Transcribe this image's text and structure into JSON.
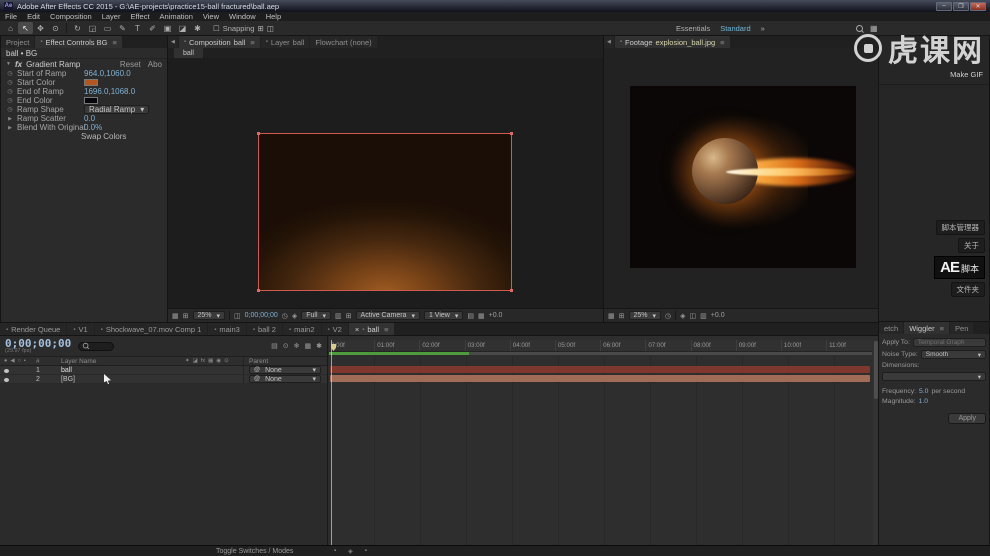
{
  "colors": {
    "render_bar_green": "#4f9a3d",
    "selection_red": "#cf5a50",
    "accent_value_blue": "#7fb0d4",
    "workspace_active_blue": "#6fb7d9"
  },
  "icons": {
    "panel_menu": "≡",
    "caret": "▾",
    "chevron_left": "◀",
    "close": "×",
    "tab_dot": "▪",
    "stopwatch": "◷",
    "twirl_open": "▼",
    "twirl_closed": "▶",
    "eye": "●",
    "audio": "◀",
    "solo": "○",
    "lock": "▪",
    "pickwhip": "@",
    "checkbox": "☐",
    "grid": "⊞",
    "safe_frame": "▦",
    "mask": "◫",
    "region": "▥",
    "channels": "◈",
    "flowchart_mini": "▤",
    "gear": "✱",
    "snowflake": "❄",
    "chart": "▦",
    "shy": "✦",
    "blend": "◪",
    "fx": "fx",
    "motion_blur": "▦",
    "adjustment": "◉",
    "cube": "⊙"
  },
  "window": {
    "app_badge": "Ae",
    "title": "Adobe After Effects CC 2015 - G:\\AE-projects\\practice15-ball fractured\\ball.aep",
    "minimize": "–",
    "maximize": "❐",
    "close": "✕"
  },
  "menu": {
    "items": [
      "File",
      "Edit",
      "Composition",
      "Layer",
      "Effect",
      "Animation",
      "View",
      "Window",
      "Help"
    ]
  },
  "toolbar": {
    "tools": [
      {
        "name": "home",
        "glyph": "⌂"
      },
      {
        "name": "selection",
        "glyph": "↖"
      },
      {
        "name": "hand",
        "glyph": "✥"
      },
      {
        "name": "zoom",
        "glyph": "⊙"
      },
      {
        "name": "orbit-camera",
        "glyph": "↻"
      },
      {
        "name": "pan-behind",
        "glyph": "◲"
      },
      {
        "name": "mask-shape",
        "glyph": "▭"
      },
      {
        "name": "pen",
        "glyph": "✎"
      },
      {
        "name": "type",
        "glyph": "T"
      },
      {
        "name": "brush",
        "glyph": "✐"
      },
      {
        "name": "clone-stamp",
        "glyph": "▣"
      },
      {
        "name": "eraser",
        "glyph": "◪"
      },
      {
        "name": "puppet-pin",
        "glyph": "✱"
      }
    ],
    "snapping_label": "Snapping",
    "workspaces": [
      {
        "label": "Essentials"
      },
      {
        "label": "Standard"
      }
    ],
    "overflow": "»"
  },
  "effect_controls": {
    "project_tab": "Project",
    "panel_title": "Effect Controls BG",
    "target": "ball • BG",
    "effect_header": {
      "fx": "fx",
      "name": "Gradient Ramp",
      "reset": "Reset",
      "about": "Abo"
    },
    "props": {
      "start_of_ramp": {
        "label": "Start of Ramp",
        "value": "964.0,1060.0"
      },
      "start_color": {
        "label": "Start Color",
        "swatch": "#b4561f"
      },
      "end_of_ramp": {
        "label": "End of Ramp",
        "value": "1696.0,1068.0"
      },
      "end_color": {
        "label": "End Color",
        "swatch": "#06060c"
      },
      "ramp_shape": {
        "label": "Ramp Shape",
        "value": "Radial Ramp"
      },
      "ramp_scatter": {
        "label": "Ramp Scatter",
        "value": "0.0"
      },
      "blend_with_original": {
        "label": "Blend With Original",
        "value": "0.0%"
      }
    },
    "swap_colors": "Swap Colors"
  },
  "composition": {
    "tab_composition": "Composition",
    "tab_composition_name": "ball",
    "tab_layer": "Layer",
    "tab_layer_name": "ball",
    "tab_flowchart": "Flowchart (none)",
    "viewer_tab": "ball",
    "statusbar": {
      "zoom": "25%",
      "timecode": "0;00;00;00",
      "resolution": "Full",
      "camera": "Active Camera",
      "views": "1 View",
      "exposure": "+0.0"
    }
  },
  "footage": {
    "tab_prefix": "Footage",
    "file_name": "explosion_ball.jpg",
    "statusbar": {
      "zoom": "25%",
      "exposure": "+0.0"
    }
  },
  "sidebar": {
    "watermark_text": "虎课网",
    "make_gif": "Make GIF",
    "script_manager": "脚本管理器",
    "about": "关于",
    "logo_big": "AE",
    "logo_small": "脚本",
    "folder": "文件夹"
  },
  "bottom_tabs": {
    "render_queue": "Render Queue",
    "comps": [
      "V1",
      "Shockwave_07.mov Comp 1",
      "main3",
      "ball 2",
      "main2",
      "V2"
    ],
    "active_comp": "ball"
  },
  "timeline": {
    "timecode": "0;00;00;00",
    "fps_note": "(29.97 fps)",
    "header": {
      "hash": "#",
      "layer_name": "Layer Name",
      "parent": "Parent"
    },
    "layers": [
      {
        "index": "1",
        "name": "ball",
        "parent": "None",
        "label_color": "#c03a2b",
        "bar_color": "#7e382d"
      },
      {
        "index": "2",
        "name": "[BG]",
        "parent": "None",
        "label_color": "#b26a58",
        "bar_color": "#a06c58"
      }
    ],
    "ruler": [
      "0:00f",
      "01:00f",
      "02:00f",
      "03:00f",
      "04:00f",
      "05:00f",
      "06:00f",
      "07:00f",
      "08:00f",
      "09:00f",
      "10:00f",
      "11:00f"
    ]
  },
  "wiggler": {
    "tab_partial": "etch",
    "tab_active": "Wiggler",
    "tab_right": "Pen",
    "rows": {
      "apply_to": {
        "label": "Apply To:",
        "value": "Temporal Graph"
      },
      "noise_type": {
        "label": "Noise Type:",
        "value": "Smooth"
      },
      "dimensions": {
        "label": "Dimensions:",
        "value": ""
      }
    },
    "frequency": {
      "label": "Frequency:",
      "value": "5.0",
      "unit": "per second"
    },
    "magnitude": {
      "label": "Magnitude:",
      "value": "1.0"
    },
    "apply_button": "Apply"
  },
  "statusbar": {
    "toggle": "Toggle Switches / Modes"
  }
}
